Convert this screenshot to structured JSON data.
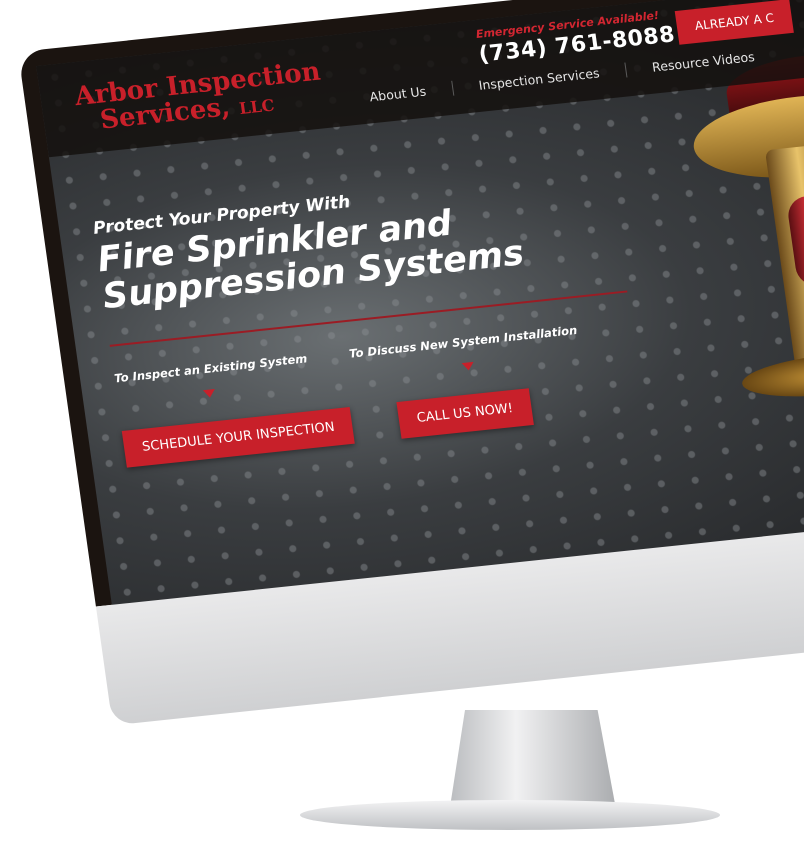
{
  "header": {
    "logo_line1": "Arbor Inspection",
    "logo_line2": "Services,",
    "logo_llc": "LLC",
    "emergency": "Emergency Service Available!",
    "phone": "(734) 761-8088",
    "already_button": "ALREADY A C",
    "nav": [
      "About Us",
      "Inspection Services",
      "Resource Videos"
    ]
  },
  "hero": {
    "small_title": "Protect Your Property With",
    "big_line1": "Fire Sprinkler and",
    "big_line2": "Suppression Systems",
    "left_label": "To Inspect an Existing System",
    "right_label": "To Discuss New System Installation",
    "left_button": "SCHEDULE YOUR INSPECTION",
    "right_button": "CALL US NOW!"
  },
  "colors": {
    "accent": "#c8202a",
    "header_bg": "#14100e"
  }
}
